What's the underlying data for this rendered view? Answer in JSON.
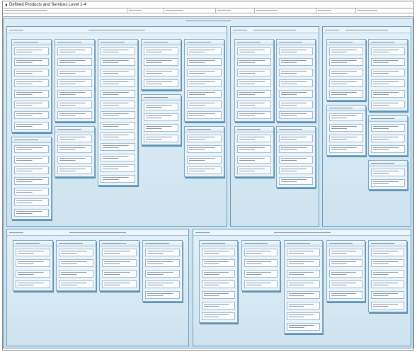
{
  "title": "Defined Products and Services Level 1-4",
  "colors": {
    "frame": "#6a9cbd",
    "card_border": "#9dbbd0",
    "group_shadow": "#5f90b3"
  },
  "panels": [
    {
      "columns": [
        [
          {
            "items": [
              "",
              "",
              "",
              "",
              "",
              "",
              "",
              ""
            ]
          },
          {
            "items": [
              "",
              "",
              "",
              "",
              "",
              "",
              ""
            ]
          }
        ],
        [
          {
            "items": [
              "",
              "",
              "",
              "",
              "",
              "",
              ""
            ]
          },
          {
            "items": [
              "",
              "",
              "",
              ""
            ]
          }
        ],
        [
          {
            "items": [
              "",
              "",
              "",
              "",
              "",
              "",
              "",
              "",
              "",
              "",
              "",
              "",
              ""
            ]
          }
        ],
        [
          {
            "items": [
              "",
              "",
              "",
              ""
            ]
          },
          {
            "items": [
              "",
              "",
              "",
              ""
            ]
          }
        ],
        [
          {
            "items": [
              "",
              "",
              "",
              "",
              "",
              "",
              ""
            ]
          },
          {
            "items": [
              "",
              "",
              "",
              ""
            ]
          }
        ]
      ]
    },
    {
      "columns": [
        [
          {
            "items": [
              "",
              "",
              "",
              "",
              "",
              "",
              ""
            ]
          },
          {
            "items": [
              "",
              "",
              "",
              ""
            ]
          }
        ],
        [
          {
            "items": [
              "",
              "",
              "",
              "",
              "",
              "",
              ""
            ]
          },
          {
            "items": [
              "",
              "",
              "",
              "",
              ""
            ]
          }
        ]
      ]
    },
    {
      "columns": [
        [
          {
            "items": [
              "",
              "",
              "",
              "",
              ""
            ]
          },
          {
            "items": [
              "",
              "",
              "",
              ""
            ]
          }
        ],
        [
          {
            "items": [
              "",
              "",
              "",
              "",
              "",
              ""
            ]
          },
          {
            "items": [
              "",
              "",
              ""
            ]
          },
          {
            "items": [
              "",
              ""
            ]
          }
        ]
      ]
    },
    {
      "columns": [
        [
          {
            "items": [
              "",
              "",
              "",
              ""
            ]
          }
        ],
        [
          {
            "items": [
              "",
              "",
              "",
              ""
            ]
          }
        ],
        [
          {
            "items": [
              "",
              "",
              "",
              ""
            ]
          }
        ],
        [
          {
            "items": [
              "",
              "",
              "",
              "",
              ""
            ]
          }
        ]
      ]
    },
    {
      "columns": [
        [
          {
            "items": [
              "",
              "",
              "",
              "",
              "",
              "",
              ""
            ]
          }
        ],
        [
          {
            "items": [
              "",
              "",
              "",
              ""
            ]
          }
        ],
        [
          {
            "items": [
              "",
              "",
              "",
              "",
              "",
              "",
              "",
              ""
            ]
          }
        ],
        [
          {
            "items": [
              "",
              "",
              "",
              "",
              ""
            ]
          }
        ],
        [
          {
            "items": [
              "",
              "",
              "",
              "",
              "",
              ""
            ]
          }
        ]
      ]
    }
  ]
}
